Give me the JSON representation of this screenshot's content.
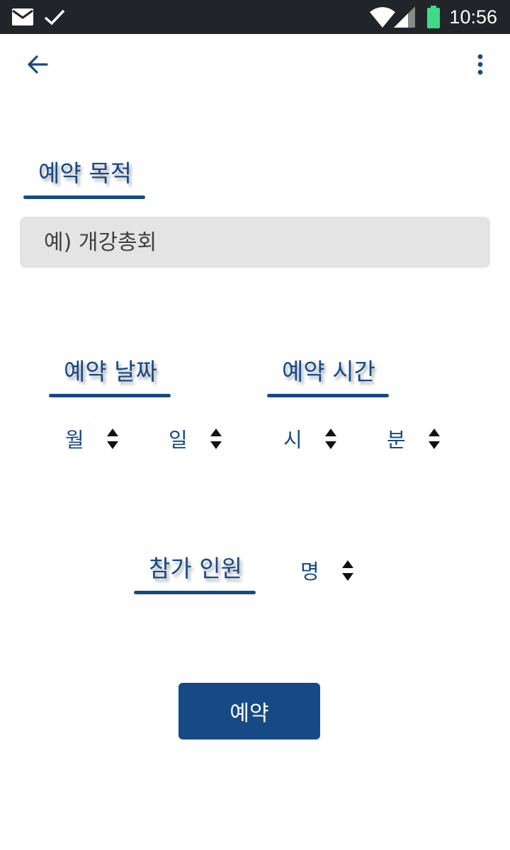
{
  "status_bar": {
    "time": "10:56",
    "icons": [
      "mail-icon",
      "check-icon",
      "wifi-icon",
      "cell-signal-icon",
      "battery-icon"
    ],
    "battery_color": "#3ddc84"
  },
  "app_bar": {
    "back_icon": "arrow-left-icon",
    "menu_icon": "more-vert-icon"
  },
  "purpose": {
    "label": "예약 목적",
    "placeholder": "예) 개강총회"
  },
  "date": {
    "label": "예약 날짜",
    "month_unit": "월",
    "day_unit": "일"
  },
  "time": {
    "label": "예약 시간",
    "hour_unit": "시",
    "minute_unit": "분"
  },
  "people": {
    "label": "참가 인원",
    "unit": "명"
  },
  "submit": {
    "label": "예약"
  },
  "colors": {
    "accent": "#174a85",
    "status_bar": "#212529",
    "input_bg": "#e4e4e4"
  }
}
